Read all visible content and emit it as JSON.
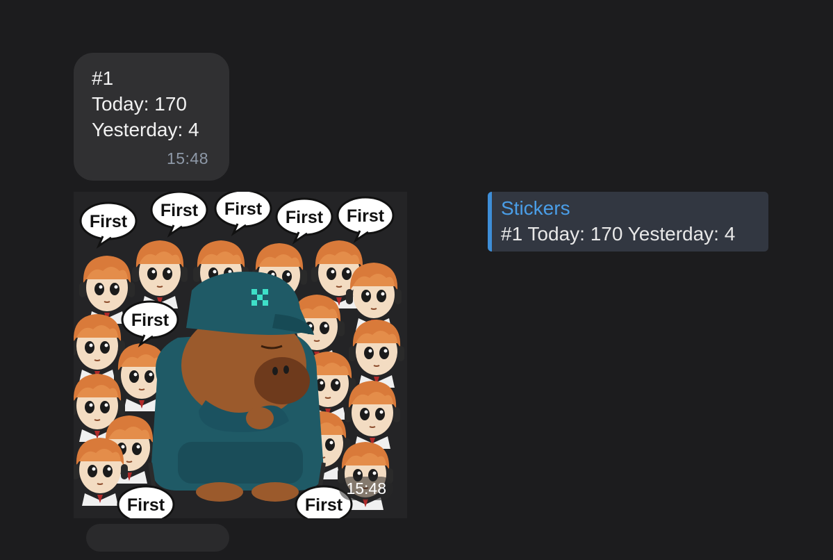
{
  "message": {
    "lines": [
      "#1",
      "Today: 170",
      "Yesterday: 4"
    ],
    "time": "15:48"
  },
  "sticker": {
    "time": "15:48",
    "bubble_text": "First",
    "cap_logo": "x-logo"
  },
  "reply": {
    "title": "Stickers",
    "text": "#1 Today: 170 Yesterday: 4"
  },
  "colors": {
    "background": "#1c1c1e",
    "bubble": "#303032",
    "accent": "#4a9ee8",
    "timestamp": "#8e99a8"
  },
  "icons": {
    "sticker": "capybara-sticker-icon"
  }
}
